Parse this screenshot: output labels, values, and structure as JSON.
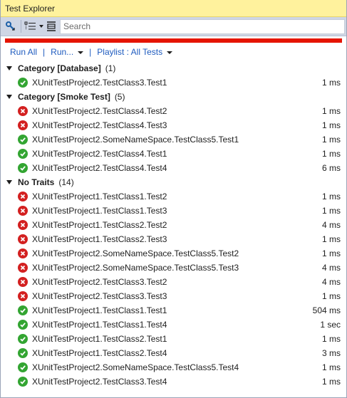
{
  "window": {
    "title": "Test Explorer"
  },
  "toolbar": {
    "search_placeholder": "Search",
    "icons": [
      "run-settings-icon",
      "group-by-icon",
      "dropdown-arrow-icon",
      "layout-icon"
    ]
  },
  "status_bar": {
    "color": "#e51400"
  },
  "actions": {
    "run_all": "Run All",
    "run": "Run...",
    "playlist": "Playlist : All Tests"
  },
  "colors": {
    "pass": "#33a532",
    "fail": "#d32020",
    "link": "#1e5bbf"
  },
  "groups": [
    {
      "title": "Category [Database]",
      "count": "(1)",
      "tests": [
        {
          "name": "XUnitTestProject2.TestClass3.Test1",
          "status": "pass",
          "duration": "1 ms"
        }
      ]
    },
    {
      "title": "Category [Smoke Test]",
      "count": "(5)",
      "tests": [
        {
          "name": "XUnitTestProject2.TestClass4.Test2",
          "status": "fail",
          "duration": "1 ms"
        },
        {
          "name": "XUnitTestProject2.TestClass4.Test3",
          "status": "fail",
          "duration": "1 ms"
        },
        {
          "name": "XUnitTestProject2.SomeNameSpace.TestClass5.Test1",
          "status": "pass",
          "duration": "1 ms"
        },
        {
          "name": "XUnitTestProject2.TestClass4.Test1",
          "status": "pass",
          "duration": "1 ms"
        },
        {
          "name": "XUnitTestProject2.TestClass4.Test4",
          "status": "pass",
          "duration": "6 ms"
        }
      ]
    },
    {
      "title": "No Traits",
      "count": "(14)",
      "tests": [
        {
          "name": "XUnitTestProject1.TestClass1.Test2",
          "status": "fail",
          "duration": "1 ms"
        },
        {
          "name": "XUnitTestProject1.TestClass1.Test3",
          "status": "fail",
          "duration": "1 ms"
        },
        {
          "name": "XUnitTestProject1.TestClass2.Test2",
          "status": "fail",
          "duration": "4 ms"
        },
        {
          "name": "XUnitTestProject1.TestClass2.Test3",
          "status": "fail",
          "duration": "1 ms"
        },
        {
          "name": "XUnitTestProject2.SomeNameSpace.TestClass5.Test2",
          "status": "fail",
          "duration": "1 ms"
        },
        {
          "name": "XUnitTestProject2.SomeNameSpace.TestClass5.Test3",
          "status": "fail",
          "duration": "4 ms"
        },
        {
          "name": "XUnitTestProject2.TestClass3.Test2",
          "status": "fail",
          "duration": "4 ms"
        },
        {
          "name": "XUnitTestProject2.TestClass3.Test3",
          "status": "fail",
          "duration": "1 ms"
        },
        {
          "name": "XUnitTestProject1.TestClass1.Test1",
          "status": "pass",
          "duration": "504 ms"
        },
        {
          "name": "XUnitTestProject1.TestClass1.Test4",
          "status": "pass",
          "duration": "1 sec"
        },
        {
          "name": "XUnitTestProject1.TestClass2.Test1",
          "status": "pass",
          "duration": "1 ms"
        },
        {
          "name": "XUnitTestProject1.TestClass2.Test4",
          "status": "pass",
          "duration": "3 ms"
        },
        {
          "name": "XUnitTestProject2.SomeNameSpace.TestClass5.Test4",
          "status": "pass",
          "duration": "1 ms"
        },
        {
          "name": "XUnitTestProject2.TestClass3.Test4",
          "status": "pass",
          "duration": "1 ms"
        }
      ]
    }
  ]
}
